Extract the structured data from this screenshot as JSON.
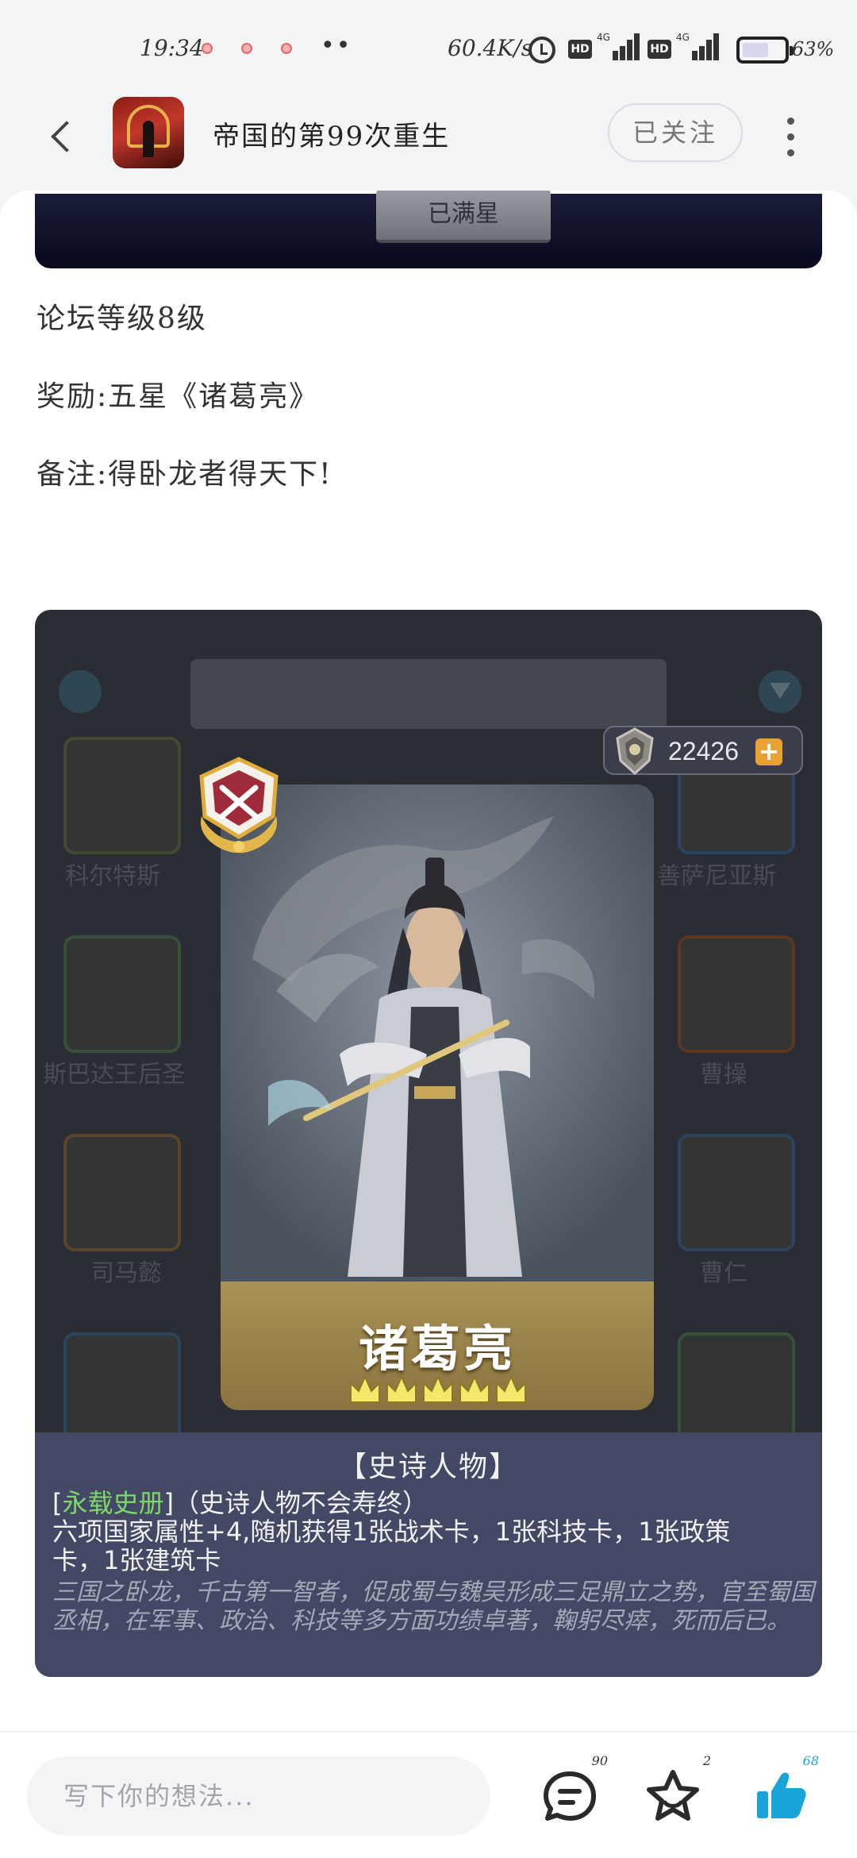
{
  "status_bar": {
    "time": "19:34",
    "notification_dots": "••",
    "network_speed": "60.4K/s",
    "hd1": "HD",
    "net1": "4G",
    "hd2": "HD",
    "net2": "4G",
    "battery_level": 0.63,
    "battery_text": "63%"
  },
  "header": {
    "title": "帝国的第99次重生",
    "follow_label": "已关注"
  },
  "post": {
    "top_image_button": "已满星",
    "lines": [
      "论坛等级8级",
      "奖励:五星《诸葛亮》",
      "备注:得卧龙者得天下!"
    ]
  },
  "game": {
    "coins": "22426",
    "plus": "+",
    "card_name": "诸葛亮",
    "stars": 5,
    "desc_title": "【史诗人物】",
    "tag_open": "[",
    "tag": "永载史册",
    "tag_rest": "]（史诗人物不会寿终）",
    "effect_line1": "六项国家属性+4,随机获得1张战术卡，1张科技卡，1张政策",
    "effect_line2": "卡，1张建筑卡",
    "quote": "三国之卧龙，千古第一智者，促成蜀与魏吴形成三足鼎立之势，官至蜀国丞相，在军事、政治、科技等多方面功绩卓著，鞠躬尽瘁，死而后已。",
    "bg_names": [
      "科尔特斯",
      "善萨尼亚斯",
      "斯巴达王后圣",
      "曹操",
      "司马懿",
      "曹仁"
    ]
  },
  "bottom_bar": {
    "comment_placeholder": "写下你的想法...",
    "comment_count": "90",
    "favorite_count": "2",
    "like_count": "68"
  },
  "colors": {
    "like_accent": "#1aa3d6",
    "tag_green": "#7ed66b",
    "coin_plus": "#e9a231"
  }
}
